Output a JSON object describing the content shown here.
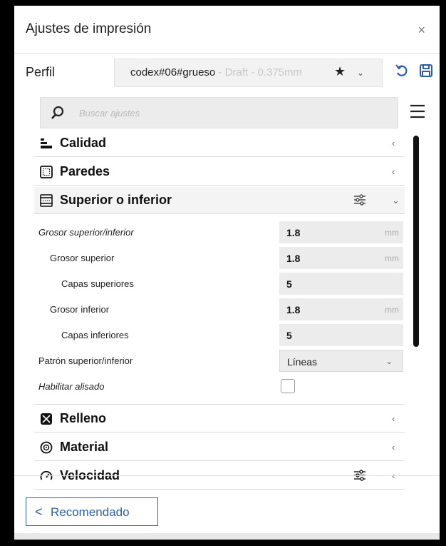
{
  "dialog": {
    "title": "Ajustes de impresión",
    "close_glyph": "×"
  },
  "profile": {
    "label": "Perfil",
    "name": "codex#06#grueso",
    "meta": " - Draft - 0.375mm",
    "star_glyph": "★",
    "chevron_glyph": "⌄"
  },
  "search": {
    "placeholder": "Buscar ajustes"
  },
  "categories": [
    {
      "label": "Calidad",
      "icon": "quality-icon",
      "chevron": "‹"
    },
    {
      "label": "Paredes",
      "icon": "walls-icon",
      "chevron": "‹"
    },
    {
      "label": "Superior o inferior",
      "icon": "top-bottom-icon",
      "chevron": "⌄"
    },
    {
      "label": "Relleno",
      "icon": "infill-icon",
      "chevron": "‹"
    },
    {
      "label": "Material",
      "icon": "material-icon",
      "chevron": "‹"
    },
    {
      "label": "Velocidad",
      "icon": "speed-icon",
      "chevron": "‹"
    }
  ],
  "settings": [
    {
      "label": "Grosor superior/inferior",
      "value": "1.8",
      "unit": "mm"
    },
    {
      "label": "Grosor superior",
      "value": "1.8",
      "unit": "mm"
    },
    {
      "label": "Capas superiores",
      "value": "5",
      "unit": ""
    },
    {
      "label": "Grosor inferior",
      "value": "1.8",
      "unit": "mm"
    },
    {
      "label": "Capas inferiores",
      "value": "5",
      "unit": ""
    },
    {
      "label": "Patrón superior/inferior",
      "value": "Líneas",
      "chevron": "⌄"
    },
    {
      "label": "Habilitar alisado",
      "checked": false
    }
  ],
  "footer": {
    "recommended_label": "Recomendado",
    "back_glyph": "<"
  },
  "colors": {
    "accent": "#2c5ea8",
    "scrollbar": "#111111"
  }
}
